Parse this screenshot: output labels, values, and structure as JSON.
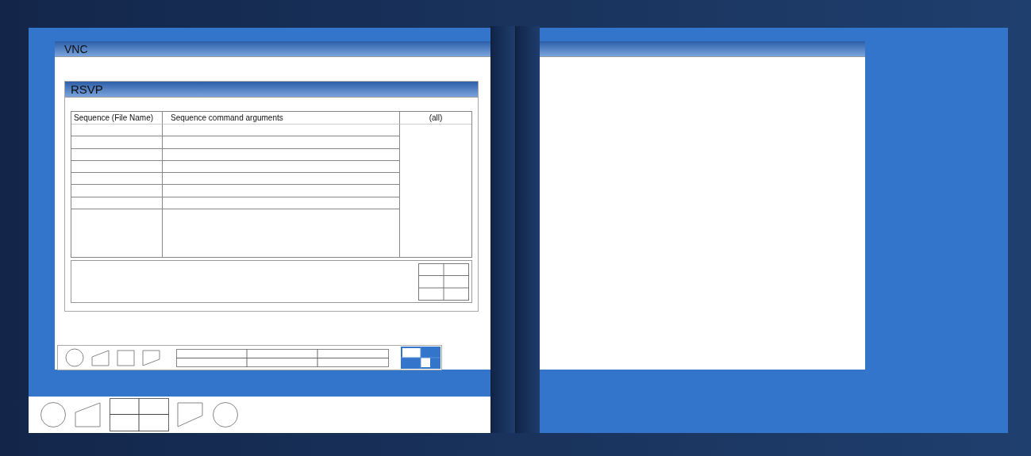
{
  "windows": [
    {
      "title": "VNC",
      "panel": {
        "title": "RSVP",
        "table": {
          "columns": [
            "Sequence (File Name)",
            "Sequence command arguments",
            "(all)"
          ]
        }
      }
    }
  ]
}
